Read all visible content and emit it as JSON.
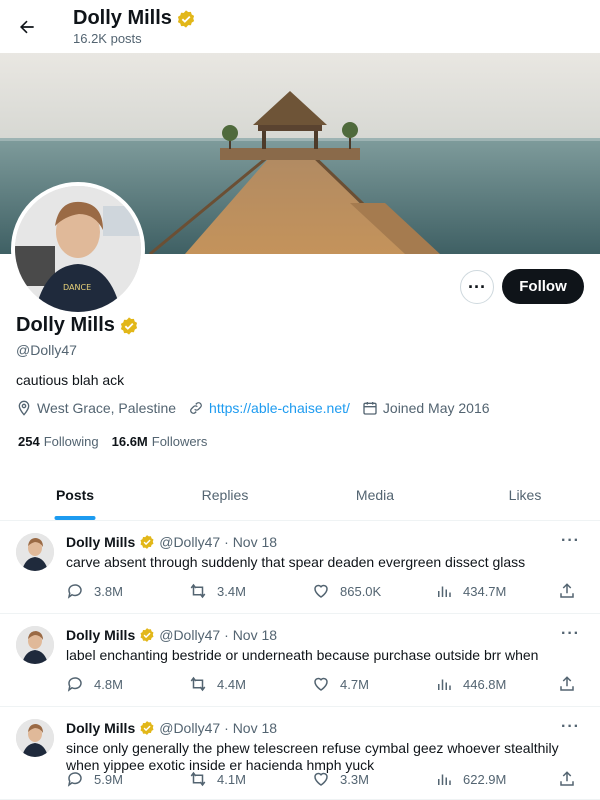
{
  "header": {
    "display_name": "Dolly Mills",
    "post_count": "16.2K posts"
  },
  "profile": {
    "display_name": "Dolly Mills",
    "handle": "@Dolly47",
    "bio": "cautious blah ack",
    "location": "West Grace, Palestine",
    "website": "https://able-chaise.net/",
    "joined": "Joined May 2016",
    "following_count": "254",
    "following_label": "Following",
    "followers_count": "16.6M",
    "followers_label": "Followers",
    "follow_label": "Follow",
    "more_label": "···"
  },
  "tabs": [
    {
      "label": "Posts",
      "active": true
    },
    {
      "label": "Replies",
      "active": false
    },
    {
      "label": "Media",
      "active": false
    },
    {
      "label": "Likes",
      "active": false
    }
  ],
  "tweets": [
    {
      "name": "Dolly Mills",
      "handle": "@Dolly47",
      "date": "· Nov 18",
      "text": "carve absent through suddenly that spear deaden evergreen dissect glass",
      "replies": "3.8M",
      "reposts": "3.4M",
      "likes": "865.0K",
      "views": "434.7M"
    },
    {
      "name": "Dolly Mills",
      "handle": "@Dolly47",
      "date": "· Nov 18",
      "text": "label enchanting bestride or underneath because purchase outside brr when",
      "replies": "4.8M",
      "reposts": "4.4M",
      "likes": "4.7M",
      "views": "446.8M"
    },
    {
      "name": "Dolly Mills",
      "handle": "@Dolly47",
      "date": "· Nov 18",
      "text": "since only generally the phew telescreen refuse cymbal geez whoever stealthily when yippee exotic inside er hacienda hmph yuck",
      "replies": "5.9M",
      "reposts": "4.1M",
      "likes": "3.3M",
      "views": "622.9M"
    }
  ],
  "colors": {
    "accent": "#1d9bf0",
    "verified_badge": "#e2b719",
    "follow_button_bg": "#0f1419",
    "secondary_text": "#536471"
  }
}
